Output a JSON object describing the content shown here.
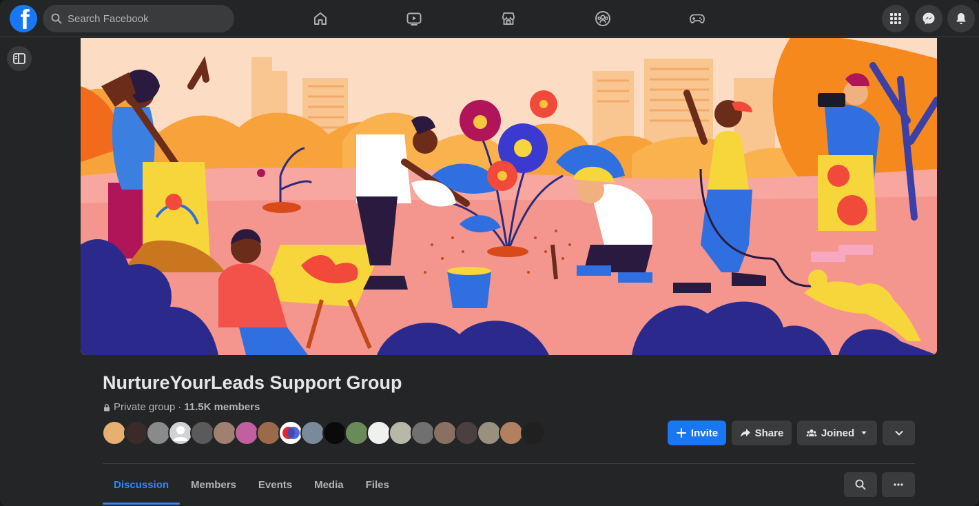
{
  "search": {
    "placeholder": "Search Facebook"
  },
  "nav": {
    "items": [
      {
        "name": "home",
        "icon": "home-icon"
      },
      {
        "name": "watch",
        "icon": "video-icon"
      },
      {
        "name": "marketplace",
        "icon": "store-icon"
      },
      {
        "name": "groups",
        "icon": "groups-icon"
      },
      {
        "name": "gaming",
        "icon": "gamepad-icon"
      }
    ]
  },
  "header_actions": [
    "menu-grid-icon",
    "messenger-icon",
    "bell-icon"
  ],
  "group": {
    "title": "NurtureYourLeads Support Group",
    "privacy": "Private group",
    "separator": "·",
    "members": "11.5K members",
    "member_avatar_count": 20
  },
  "actions": {
    "invite": "Invite",
    "share": "Share",
    "joined": "Joined"
  },
  "tabs": [
    {
      "label": "Discussion",
      "active": true
    },
    {
      "label": "Members",
      "active": false
    },
    {
      "label": "Events",
      "active": false
    },
    {
      "label": "Media",
      "active": false
    },
    {
      "label": "Files",
      "active": false
    }
  ],
  "colors": {
    "accent": "#1877f2",
    "tab_active": "#2d88ff",
    "background": "#242526",
    "button_bg": "#3a3b3c"
  }
}
